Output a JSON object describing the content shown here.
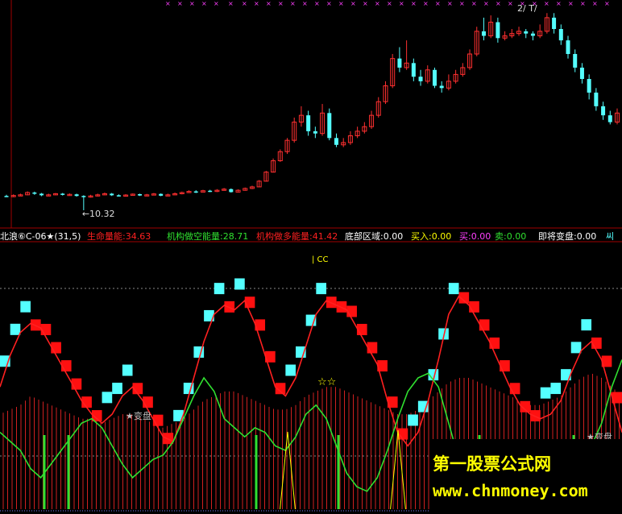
{
  "chart_data": [
    {
      "type": "candlestick",
      "title": "",
      "annotations": {
        "low_marker": "←10.32",
        "top_label": "2/ T/"
      },
      "candles": [
        [
          10.95,
          10.92,
          11.0,
          10.9
        ],
        [
          10.92,
          10.97,
          11.02,
          10.9
        ],
        [
          10.97,
          11.0,
          11.05,
          10.94
        ],
        [
          11.0,
          11.1,
          11.15,
          10.98
        ],
        [
          11.1,
          11.05,
          11.14,
          11.0
        ],
        [
          11.05,
          10.98,
          11.08,
          10.94
        ],
        [
          10.98,
          11.0,
          11.05,
          10.95
        ],
        [
          11.0,
          11.05,
          11.08,
          10.98
        ],
        [
          11.05,
          11.0,
          11.08,
          10.97
        ],
        [
          11.0,
          11.02,
          11.06,
          10.98
        ],
        [
          11.02,
          10.95,
          11.05,
          10.92
        ],
        [
          10.95,
          10.9,
          10.98,
          10.32
        ],
        [
          10.9,
          10.95,
          11.0,
          10.88
        ],
        [
          10.95,
          11.0,
          11.05,
          10.93
        ],
        [
          11.0,
          11.05,
          11.1,
          10.98
        ],
        [
          11.05,
          10.98,
          11.08,
          10.95
        ],
        [
          10.98,
          10.96,
          11.02,
          10.93
        ],
        [
          10.96,
          10.99,
          11.03,
          10.94
        ],
        [
          10.99,
          11.03,
          11.06,
          10.97
        ],
        [
          11.03,
          10.97,
          11.05,
          10.95
        ],
        [
          10.97,
          11.0,
          11.04,
          10.95
        ],
        [
          11.0,
          11.04,
          11.08,
          10.98
        ],
        [
          11.04,
          10.96,
          11.06,
          10.94
        ],
        [
          10.96,
          11.0,
          11.05,
          10.95
        ],
        [
          11.0,
          11.05,
          11.1,
          10.98
        ],
        [
          11.05,
          11.1,
          11.14,
          11.02
        ],
        [
          11.1,
          11.15,
          11.2,
          11.08
        ],
        [
          11.15,
          11.12,
          11.2,
          11.08
        ],
        [
          11.12,
          11.18,
          11.22,
          11.1
        ],
        [
          11.18,
          11.15,
          11.22,
          11.12
        ],
        [
          11.15,
          11.2,
          11.25,
          11.12
        ],
        [
          11.2,
          11.25,
          11.3,
          11.18
        ],
        [
          11.25,
          11.12,
          11.28,
          11.1
        ],
        [
          11.12,
          11.2,
          11.24,
          11.1
        ],
        [
          11.2,
          11.28,
          11.32,
          11.18
        ],
        [
          11.28,
          11.35,
          11.4,
          11.25
        ],
        [
          11.35,
          11.6,
          11.65,
          11.33
        ],
        [
          11.6,
          12.0,
          12.05,
          11.58
        ],
        [
          12.0,
          12.5,
          12.6,
          11.98
        ],
        [
          12.5,
          12.9,
          13.0,
          12.45
        ],
        [
          12.9,
          13.4,
          13.5,
          12.8
        ],
        [
          13.4,
          14.2,
          14.4,
          13.3
        ],
        [
          14.2,
          14.5,
          14.9,
          14.0
        ],
        [
          14.5,
          13.8,
          14.7,
          13.6
        ],
        [
          13.8,
          13.7,
          14.0,
          13.5
        ],
        [
          13.7,
          14.6,
          15.0,
          13.6
        ],
        [
          14.6,
          13.5,
          14.8,
          13.4
        ],
        [
          13.5,
          13.2,
          13.7,
          13.1
        ],
        [
          13.2,
          13.3,
          13.5,
          13.1
        ],
        [
          13.3,
          13.6,
          13.8,
          13.2
        ],
        [
          13.6,
          13.8,
          14.0,
          13.5
        ],
        [
          13.8,
          14.0,
          14.2,
          13.7
        ],
        [
          14.0,
          14.5,
          14.7,
          13.9
        ],
        [
          14.5,
          15.1,
          15.3,
          14.4
        ],
        [
          15.1,
          15.8,
          16.0,
          15.0
        ],
        [
          15.8,
          17.0,
          17.2,
          15.7
        ],
        [
          17.0,
          16.6,
          17.5,
          16.4
        ],
        [
          16.6,
          16.8,
          17.8,
          16.5
        ],
        [
          16.8,
          16.2,
          17.0,
          16.0
        ],
        [
          16.2,
          16.0,
          16.5,
          15.8
        ],
        [
          16.0,
          16.5,
          16.7,
          15.9
        ],
        [
          16.5,
          15.8,
          16.6,
          15.7
        ],
        [
          15.8,
          15.7,
          16.0,
          15.5
        ],
        [
          15.7,
          16.0,
          16.3,
          15.6
        ],
        [
          16.0,
          16.3,
          16.5,
          15.9
        ],
        [
          16.3,
          16.6,
          16.8,
          16.2
        ],
        [
          16.6,
          17.2,
          17.4,
          16.5
        ],
        [
          17.2,
          18.2,
          18.4,
          17.1
        ],
        [
          18.2,
          18.0,
          18.8,
          17.8
        ],
        [
          18.0,
          18.6,
          18.9,
          17.9
        ],
        [
          18.6,
          17.9,
          18.8,
          17.7
        ],
        [
          17.9,
          18.0,
          18.2,
          17.8
        ],
        [
          18.0,
          18.1,
          18.3,
          17.9
        ],
        [
          18.1,
          18.2,
          18.4,
          18.0
        ],
        [
          18.2,
          18.1,
          18.3,
          17.9
        ],
        [
          18.1,
          18.0,
          18.2,
          17.8
        ],
        [
          18.0,
          18.2,
          18.5,
          17.9
        ],
        [
          18.2,
          18.8,
          19.0,
          18.1
        ],
        [
          18.8,
          18.3,
          19.0,
          18.1
        ],
        [
          18.3,
          17.8,
          18.5,
          17.6
        ],
        [
          17.8,
          17.2,
          18.0,
          17.0
        ],
        [
          17.2,
          16.6,
          17.4,
          16.4
        ],
        [
          16.6,
          16.1,
          16.8,
          15.9
        ],
        [
          16.1,
          15.5,
          16.3,
          15.2
        ],
        [
          15.5,
          14.9,
          15.7,
          14.7
        ],
        [
          14.9,
          14.5,
          15.1,
          14.3
        ],
        [
          14.5,
          14.2,
          14.7,
          14.1
        ],
        [
          14.2,
          14.6,
          14.8,
          14.1
        ]
      ]
    },
    {
      "type": "indicator",
      "title": "北浪⑥C-06★(31,5)",
      "labels": [
        {
          "text": "生命量能:34.63",
          "color": "#ff2020"
        },
        {
          "text": "机构做空能量:28.71",
          "color": "#30e030"
        },
        {
          "text": "机构做多能量:41.42",
          "color": "#ff2020"
        },
        {
          "text": "底部区域:0.00",
          "color": "#ffffff"
        },
        {
          "text": "买入:0.00",
          "color": "#ffff00"
        },
        {
          "text": "买:0.00",
          "color": "#ff40ff"
        },
        {
          "text": "卖:0.00",
          "color": "#30e030"
        },
        {
          "text": "即将变盘:0.00",
          "color": "#ffffff"
        }
      ],
      "annotations": [
        "变盘",
        "变盘",
        "☆☆"
      ],
      "series": [
        {
          "name": "机构做多能量",
          "color": "#ff2020",
          "values": [
            28,
            35,
            40,
            42,
            41,
            37,
            33,
            29,
            25,
            22,
            20,
            22,
            26,
            28,
            25,
            21,
            17,
            16,
            22,
            30,
            38,
            44,
            46,
            45,
            47,
            42,
            35,
            28,
            26,
            30,
            37,
            44,
            47,
            46,
            45,
            41,
            37,
            33,
            25,
            18,
            15,
            18,
            25,
            34,
            44,
            48,
            46,
            42,
            38,
            33,
            28,
            24,
            22,
            21,
            22,
            25,
            31,
            36,
            38,
            34,
            26,
            18
          ]
        },
        {
          "name": "机构做空能量",
          "color": "#30e030",
          "values": [
            18,
            16,
            14,
            10,
            8,
            11,
            14,
            17,
            20,
            21,
            19,
            15,
            11,
            8,
            10,
            12,
            13,
            16,
            21,
            26,
            30,
            27,
            21,
            19,
            17,
            19,
            18,
            15,
            14,
            17,
            22,
            24,
            21,
            15,
            9,
            6,
            5,
            8,
            14,
            21,
            27,
            30,
            31,
            28,
            20,
            12,
            7,
            4,
            6,
            8,
            10,
            9,
            10,
            11,
            12,
            11,
            12,
            13,
            15,
            20,
            28,
            34
          ]
        },
        {
          "name": "生命量能",
          "color": "#ff2020",
          "values": [
            20,
            21,
            22,
            24,
            23,
            22,
            21,
            20,
            19,
            19,
            18,
            19,
            20,
            20,
            19,
            18,
            17,
            18,
            19,
            21,
            23,
            24,
            25,
            25,
            24,
            23,
            22,
            21,
            21,
            22,
            24,
            25,
            26,
            26,
            25,
            24,
            23,
            22,
            21,
            20,
            20,
            21,
            23,
            25,
            27,
            28,
            28,
            27,
            26,
            25,
            24,
            23,
            22,
            22,
            23,
            24,
            26,
            28,
            29,
            28,
            26,
            24
          ]
        }
      ]
    }
  ]
}
